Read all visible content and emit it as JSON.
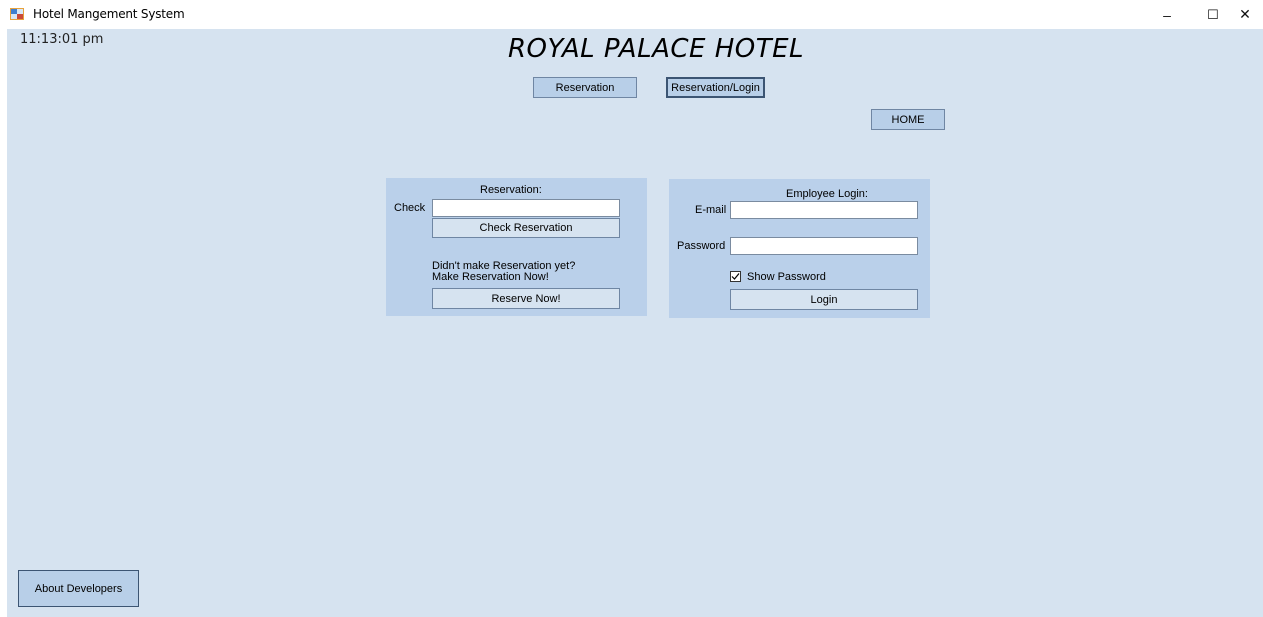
{
  "window": {
    "title": "Hotel Mangement System",
    "controls": {
      "minimize": "–",
      "maximize": "☐",
      "close": "✕"
    }
  },
  "header": {
    "clock": "11:13:01 pm",
    "hotel_name": "ROYAL PALACE HOTEL"
  },
  "nav": {
    "reservation_label": "Reservation",
    "reservation_login_label": "Reservation/Login",
    "home_label": "HOME"
  },
  "reservation_panel": {
    "heading": "Reservation:",
    "check_label": "Check",
    "check_value": "",
    "check_button": "Check Reservation",
    "prompt_line1": "Didn't make Reservation yet?",
    "prompt_line2": "Make Reservation Now!",
    "reserve_button": "Reserve Now!"
  },
  "login_panel": {
    "heading": "Employee Login:",
    "email_label": "E-mail",
    "email_value": "",
    "password_label": "Password",
    "password_value": "",
    "show_password_label": "Show Password",
    "show_password_checked": true,
    "login_button": "Login"
  },
  "footer": {
    "about_button": "About Developers"
  },
  "colors": {
    "client_bg": "#d6e3f0",
    "panel_bg": "#bad0ea",
    "button_bg": "#b8cfe8"
  }
}
